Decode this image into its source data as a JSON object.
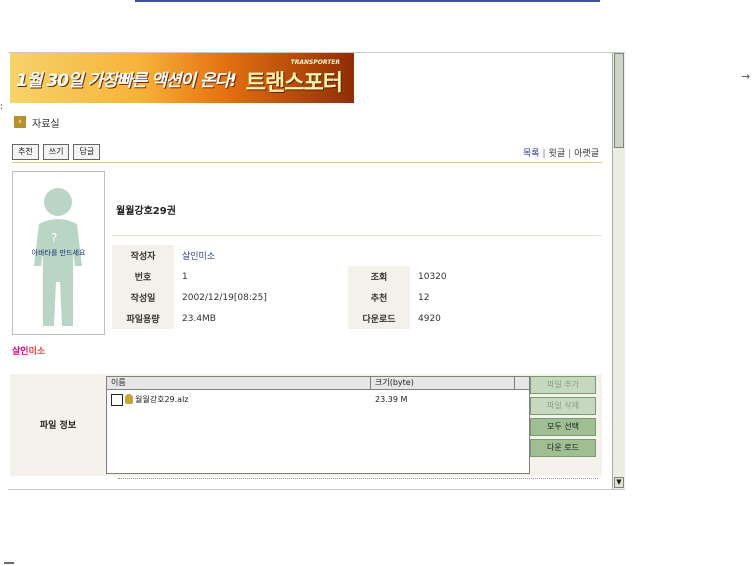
{
  "banner": {
    "left_text": "1월 30일 가장빠른 액션이 온다!",
    "small_text": "TRANSPORTER",
    "right_text": "트랜스포터"
  },
  "section": {
    "title": "자료실"
  },
  "toolbar": {
    "buttons": [
      "추천",
      "쓰기",
      "답글"
    ],
    "links": [
      "목록",
      "윗글",
      "아랫글"
    ]
  },
  "post": {
    "title": "월월강호29권",
    "avatar_text": "아바타를 만드세요",
    "author_display": "살인미소",
    "fields": {
      "author_label": "작성자",
      "author": "살인미소",
      "number_label": "번호",
      "number": "1",
      "views_label": "조회",
      "views": "10320",
      "date_label": "작성일",
      "date": "2002/12/19[08:25]",
      "recommend_label": "추천",
      "recommend": "12",
      "size_label": "파일용량",
      "size": "23.4MB",
      "downloads_label": "다운로드",
      "downloads": "4920"
    }
  },
  "file_info": {
    "label": "파일 정보",
    "col_name": "이름",
    "col_size": "크기(byte)",
    "file": {
      "name": "월월강호29.alz",
      "size": "23.39 M"
    },
    "buttons": [
      "파일 추가",
      "파일 삭제",
      "모두 선택",
      "다운 로드"
    ]
  },
  "colors": {
    "banner_start": "#f6d36a",
    "banner_end": "#8f2e06",
    "link": "#2a3f9e",
    "author_pink": "#e0007c",
    "author_red": "#ff3b30",
    "file_button": "#9fbf93"
  }
}
